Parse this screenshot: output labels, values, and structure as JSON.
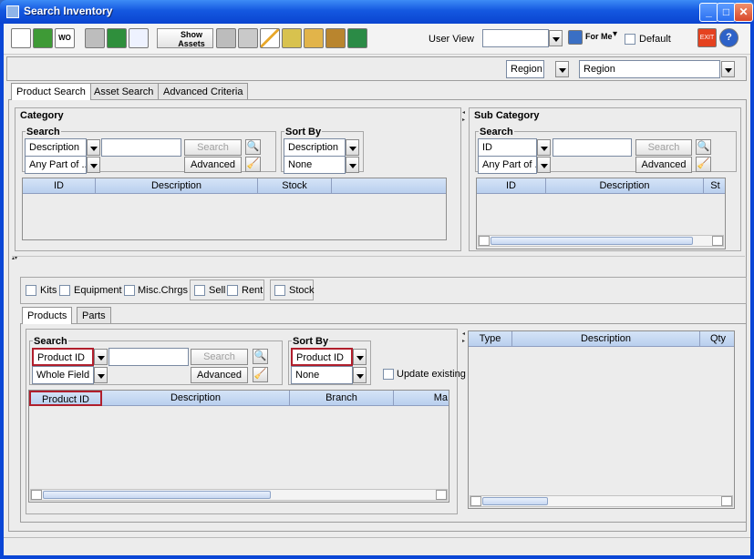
{
  "window": {
    "title": "Search Inventory"
  },
  "toolbar": {
    "show_assets": "Show Assets",
    "user_view_label": "User View",
    "user_view_value": "",
    "for_me": "For Me",
    "default_label": "Default"
  },
  "filter": {
    "region_field_1": "Region",
    "region_field_2": "Region"
  },
  "main_tabs": [
    "Product Search",
    "Asset Search",
    "Advanced Criteria"
  ],
  "category": {
    "title": "Category",
    "search_title": "Search",
    "field": "Description",
    "match": "Any Part of ...",
    "search_button": "Search",
    "advanced_button": "Advanced",
    "sort_title": "Sort By",
    "sort1": "Description",
    "sort2": "None",
    "columns": [
      "ID",
      "Description",
      "Stock"
    ]
  },
  "subcategory": {
    "title": "Sub Category",
    "search_title": "Search",
    "field": "ID",
    "match": "Any Part of ...",
    "search_button": "Search",
    "advanced_button": "Advanced",
    "columns": [
      "ID",
      "Description",
      "St"
    ]
  },
  "filters": {
    "kits": "Kits",
    "equipment": "Equipment",
    "misc": "Misc.Chrgs",
    "sell": "Sell",
    "rent": "Rent",
    "stock": "Stock"
  },
  "product_tabs": [
    "Products",
    "Parts"
  ],
  "products": {
    "search_title": "Search",
    "field": "Product ID",
    "match": "Whole Field",
    "search_button": "Search",
    "advanced_button": "Advanced",
    "sort_title": "Sort By",
    "sort1": "Product ID",
    "sort2": "None",
    "update_existing": "Update existing",
    "columns": [
      "Product ID",
      "Description",
      "Branch",
      "Ma"
    ]
  },
  "detail": {
    "columns": [
      "Type",
      "Description",
      "Qty"
    ]
  }
}
